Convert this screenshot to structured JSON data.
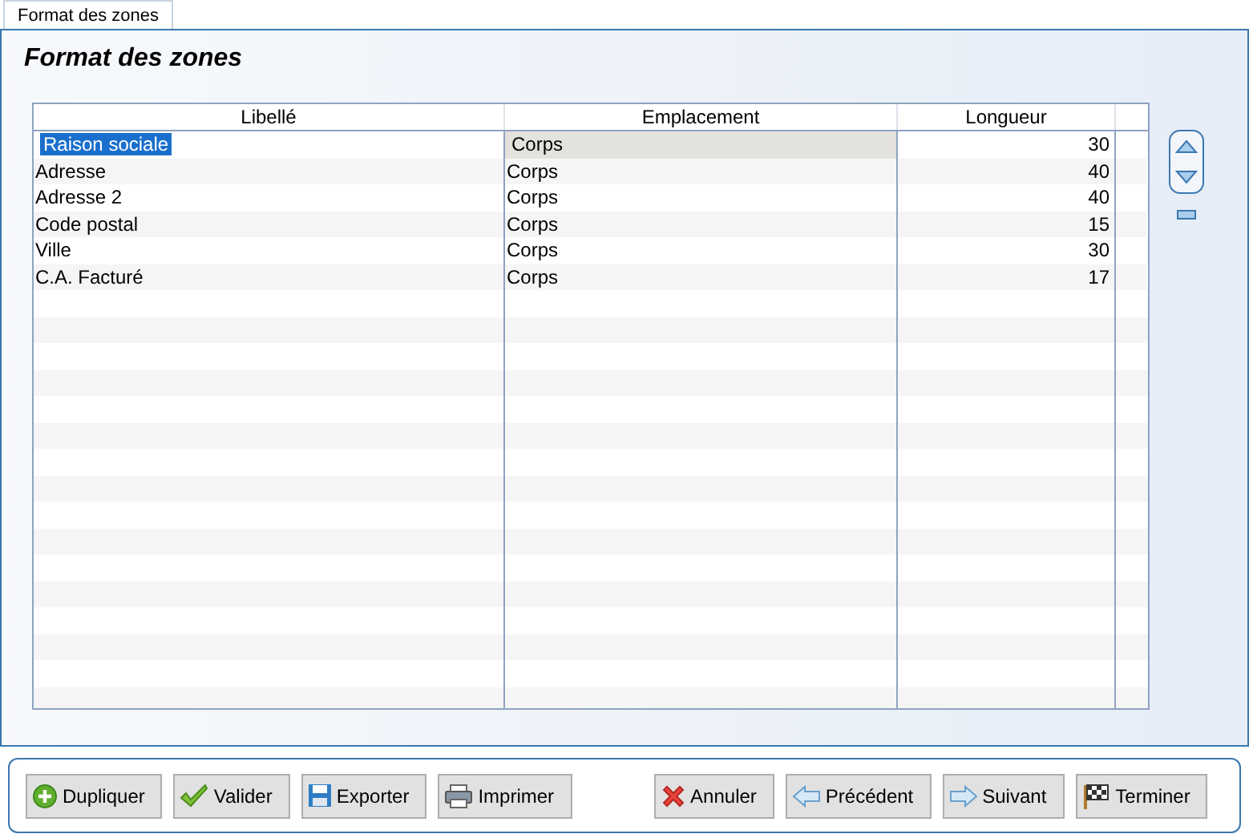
{
  "tab": {
    "label": "Format des zones",
    "selected": true
  },
  "title": "Format des zones",
  "table": {
    "columns": [
      "Libellé",
      "Emplacement",
      "Longueur"
    ],
    "rows": [
      {
        "libelle": "Raison sociale",
        "emplacement": "Corps",
        "longueur": "30",
        "selected": true
      },
      {
        "libelle": "Adresse",
        "emplacement": "Corps",
        "longueur": "40",
        "selected": false
      },
      {
        "libelle": "Adresse 2",
        "emplacement": "Corps",
        "longueur": "40",
        "selected": false
      },
      {
        "libelle": "Code postal",
        "emplacement": "Corps",
        "longueur": "15",
        "selected": false
      },
      {
        "libelle": "Ville",
        "emplacement": "Corps",
        "longueur": "30",
        "selected": false
      },
      {
        "libelle": "C.A. Facturé",
        "emplacement": "Corps",
        "longueur": "17",
        "selected": false
      }
    ]
  },
  "buttons_left": [
    {
      "label": "Dupliquer",
      "kind": "plus"
    },
    {
      "label": "Valider",
      "kind": "check"
    },
    {
      "label": "Exporter",
      "kind": "disk"
    },
    {
      "label": "Imprimer",
      "kind": "printer"
    }
  ],
  "buttons_right": [
    {
      "label": "Annuler",
      "kind": "cross"
    },
    {
      "label": "Précédent",
      "kind": "back"
    },
    {
      "label": "Suivant",
      "kind": "forward"
    },
    {
      "label": "Terminer",
      "kind": "flag"
    }
  ]
}
